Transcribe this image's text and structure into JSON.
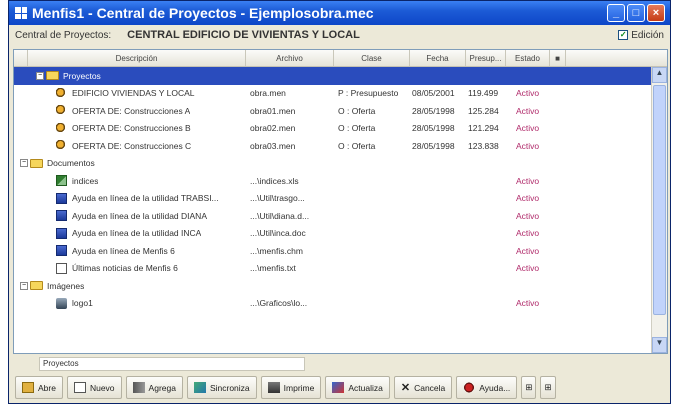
{
  "window": {
    "title": "Menfis1 - Central de Proyectos - Ejemplosobra.mec"
  },
  "infobar": {
    "label": "Central de Proyectos:",
    "value": "CENTRAL EDIFICIO DE VIVIENTAS Y LOCAL",
    "edicion_label": "Edición",
    "edicion_checked": true
  },
  "columns": {
    "descripcion": "Descripción",
    "archivo": "Archivo",
    "clase": "Clase",
    "fecha": "Fecha",
    "presupuesto": "Presup...",
    "estado": "Estado"
  },
  "rows": [
    {
      "type": "group",
      "label": "Proyectos",
      "archivo": "",
      "clase": "",
      "fecha": "",
      "pres": "",
      "estado": ""
    },
    {
      "type": "item",
      "icon": "work-icon",
      "label": "EDIFICIO VIVIENDAS Y LOCAL",
      "archivo": "obra.men",
      "clase": "P : Presupuesto",
      "fecha": "08/05/2001",
      "pres": "119.499",
      "estado": "Activo"
    },
    {
      "type": "item",
      "icon": "work-icon",
      "label": "OFERTA DE: Construcciones A",
      "archivo": "obra01.men",
      "clase": "O : Oferta",
      "fecha": "28/05/1998",
      "pres": "125.284",
      "estado": "Activo"
    },
    {
      "type": "item",
      "icon": "work-icon",
      "label": "OFERTA DE: Construcciones B",
      "archivo": "obra02.men",
      "clase": "O : Oferta",
      "fecha": "28/05/1998",
      "pres": "121.294",
      "estado": "Activo"
    },
    {
      "type": "item",
      "icon": "work-icon",
      "label": "OFERTA DE: Construcciones C",
      "archivo": "obra03.men",
      "clase": "O : Oferta",
      "fecha": "28/05/1998",
      "pres": "123.838",
      "estado": "Activo"
    },
    {
      "type": "folder",
      "label": "Documentos",
      "archivo": "",
      "clase": "",
      "fecha": "",
      "pres": "",
      "estado": ""
    },
    {
      "type": "item",
      "icon": "spreadsheet-icon",
      "label": "indices",
      "archivo": "...\\indices.xls",
      "clase": "",
      "fecha": "",
      "pres": "",
      "estado": "Activo"
    },
    {
      "type": "item",
      "icon": "help-icon",
      "label": "Ayuda en línea de la utilidad TRABSI...",
      "archivo": "...\\Util\\trasgo...",
      "clase": "",
      "fecha": "",
      "pres": "",
      "estado": "Activo"
    },
    {
      "type": "item",
      "icon": "help-icon",
      "label": "Ayuda en línea de la utilidad DIANA",
      "archivo": "...\\Util\\diana.d...",
      "clase": "",
      "fecha": "",
      "pres": "",
      "estado": "Activo"
    },
    {
      "type": "item",
      "icon": "help-icon",
      "label": "Ayuda en línea de la utilidad INCA",
      "archivo": "...\\Util\\inca.doc",
      "clase": "",
      "fecha": "",
      "pres": "",
      "estado": "Activo"
    },
    {
      "type": "item",
      "icon": "help-icon",
      "label": "Ayuda en línea de Menfis 6",
      "archivo": "...\\menfis.chm",
      "clase": "",
      "fecha": "",
      "pres": "",
      "estado": "Activo"
    },
    {
      "type": "item",
      "icon": "document-icon",
      "label": "Últimas noticias de Menfis 6",
      "archivo": "...\\menfis.txt",
      "clase": "",
      "fecha": "",
      "pres": "",
      "estado": "Activo"
    },
    {
      "type": "folder",
      "label": "Imágenes",
      "archivo": "",
      "clase": "",
      "fecha": "",
      "pres": "",
      "estado": ""
    },
    {
      "type": "item",
      "icon": "image-icon",
      "label": "logo1",
      "archivo": "...\\Graficos\\lo...",
      "clase": "",
      "fecha": "",
      "pres": "",
      "estado": "Activo"
    }
  ],
  "status": {
    "text": "Proyectos"
  },
  "toolbar": {
    "abrir": "Abre",
    "nuevo": "Nuevo",
    "agrega": "Agrega",
    "sincroniza": "Sincroniza",
    "imprime": "Imprime",
    "actualiza": "Actualiza",
    "cancela": "Cancela",
    "ayuda": "Ayuda..."
  }
}
